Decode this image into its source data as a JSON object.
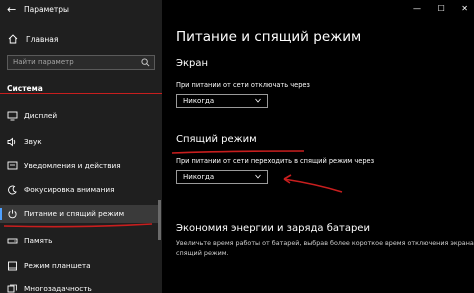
{
  "window": {
    "title": "Параметры",
    "controls": {
      "minimize": "—",
      "maximize": "☐",
      "close": "✕"
    }
  },
  "sidebar": {
    "back_icon": "back-arrow-icon",
    "home_label": "Главная",
    "search_placeholder": "Найти параметр",
    "group_label": "Система",
    "items": [
      {
        "label": "Дисплей",
        "icon": "display-icon"
      },
      {
        "label": "Звук",
        "icon": "sound-icon"
      },
      {
        "label": "Уведомления и действия",
        "icon": "notifications-icon"
      },
      {
        "label": "Фокусировка внимания",
        "icon": "focus-assist-icon"
      },
      {
        "label": "Питание и спящий режим",
        "icon": "power-icon",
        "selected": true
      },
      {
        "label": "Память",
        "icon": "storage-icon"
      },
      {
        "label": "Режим планшета",
        "icon": "tablet-icon"
      },
      {
        "label": "Многозадачность",
        "icon": "multitasking-icon"
      }
    ]
  },
  "main": {
    "page_title": "Питание и спящий режим",
    "screen_section": {
      "heading": "Экран",
      "label": "При питании от сети отключать через",
      "value": "Никогда"
    },
    "sleep_section": {
      "heading": "Спящий режим",
      "label": "При питании от сети переходить в спящий режим через",
      "value": "Никогда"
    },
    "battery_section": {
      "heading": "Экономия энергии и заряда батареи",
      "desc_line1": "Увеличьте время работы от батарей, выбрав более короткое время отключения экрана и перехода в",
      "desc_line2": "спящий режим."
    }
  },
  "colors": {
    "background": "#000000",
    "sidebar": "#1f1f1f",
    "selected_item": "#3a3a3a",
    "accent": "#4ea0ff",
    "annotation": "#c81e1e"
  }
}
